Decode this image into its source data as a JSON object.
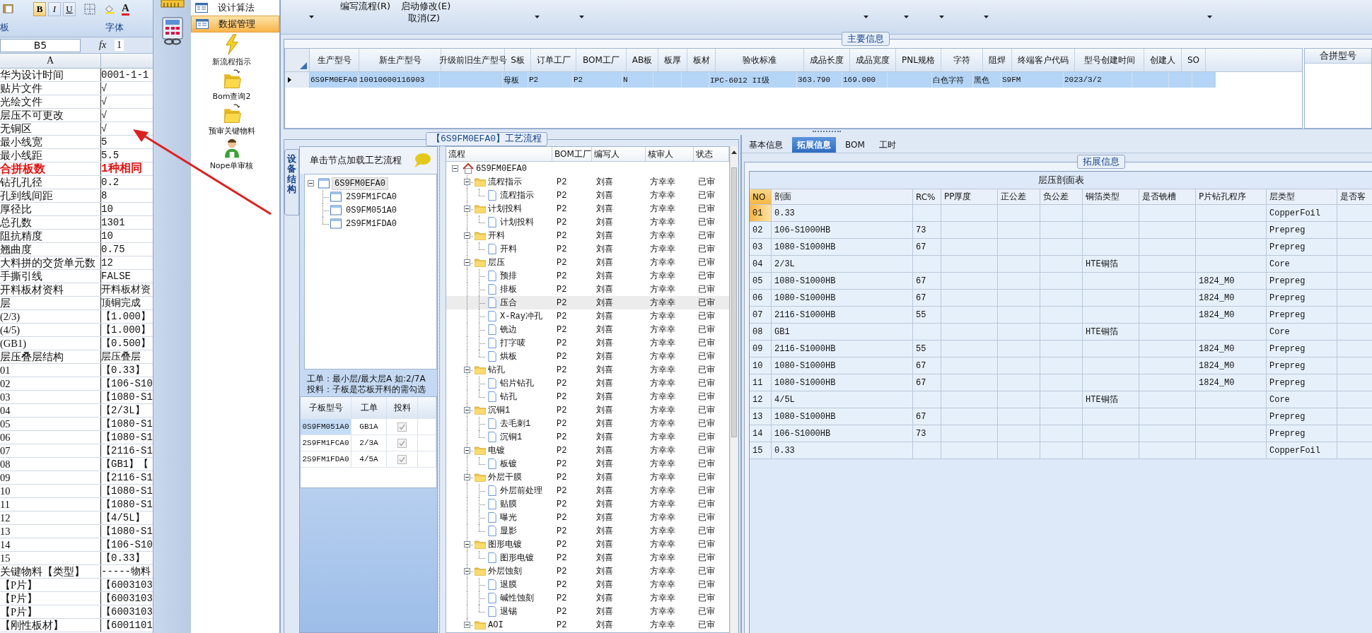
{
  "excel": {
    "format_buttons": [
      "B",
      "I",
      "U"
    ],
    "font_color_label": "A",
    "group_labels": [
      "板",
      "字体"
    ],
    "name_box": "B5",
    "fx_label": "fx",
    "formula_value": "1",
    "column_header": "A",
    "rows": [
      {
        "label": "华为设计时间",
        "value": "0001-1-1",
        "emphasized": false
      },
      {
        "label": "贴片文件",
        "value": "√",
        "emphasized": false
      },
      {
        "label": "光绘文件",
        "value": "√",
        "emphasized": false
      },
      {
        "label": "层压不可更改",
        "value": "√",
        "emphasized": false
      },
      {
        "label": "无铜区",
        "value": "√",
        "emphasized": false
      },
      {
        "label": "最小线宽",
        "value": "5",
        "emphasized": false
      },
      {
        "label": "最小线距",
        "value": "5.5",
        "emphasized": false
      },
      {
        "label": "合拼板数",
        "value": "1种相同",
        "emphasized": true
      },
      {
        "label": "钻孔孔径",
        "value": "0.2",
        "emphasized": false
      },
      {
        "label": "孔到线间距",
        "value": "8",
        "emphasized": false
      },
      {
        "label": "厚径比",
        "value": "10",
        "emphasized": false
      },
      {
        "label": "总孔数",
        "value": "1301",
        "emphasized": false
      },
      {
        "label": "阻抗精度",
        "value": "10",
        "emphasized": false
      },
      {
        "label": "翘曲度",
        "value": "0.75",
        "emphasized": false
      },
      {
        "label": "大料拼的交货单元数",
        "value": "12",
        "emphasized": false
      },
      {
        "label": "手撕引线",
        "value": "FALSE",
        "emphasized": false
      },
      {
        "label": "开料板材资料",
        "value": "开料板材资",
        "emphasized": false
      },
      {
        "label": "层",
        "value": "顶铜完成",
        "emphasized": false
      },
      {
        "label": "(2/3)",
        "value": "【1.000】",
        "emphasized": false
      },
      {
        "label": "(4/5)",
        "value": "【1.000】",
        "emphasized": false
      },
      {
        "label": "(GB1)",
        "value": "【0.500】",
        "emphasized": false
      },
      {
        "label": "层压叠层结构",
        "value": "层压叠层",
        "emphasized": false
      },
      {
        "label": "01",
        "value": "【0.33】",
        "emphasized": false
      },
      {
        "label": "02",
        "value": "【106-S10",
        "emphasized": false
      },
      {
        "label": "03",
        "value": "【1080-S1",
        "emphasized": false
      },
      {
        "label": "04",
        "value": "【2/3L】",
        "emphasized": false
      },
      {
        "label": "05",
        "value": "【1080-S1",
        "emphasized": false
      },
      {
        "label": "06",
        "value": "【1080-S1",
        "emphasized": false
      },
      {
        "label": "07",
        "value": "【2116-S1",
        "emphasized": false
      },
      {
        "label": "08",
        "value": "【GB1】【",
        "emphasized": false
      },
      {
        "label": "09",
        "value": "【2116-S1",
        "emphasized": false
      },
      {
        "label": "10",
        "value": "【1080-S1",
        "emphasized": false
      },
      {
        "label": "11",
        "value": "【1080-S1",
        "emphasized": false
      },
      {
        "label": "12",
        "value": "【4/5L】",
        "emphasized": false
      },
      {
        "label": "13",
        "value": "【1080-S1",
        "emphasized": false
      },
      {
        "label": "14",
        "value": "【106-S10",
        "emphasized": false
      },
      {
        "label": "15",
        "value": "【0.33】",
        "emphasized": false
      },
      {
        "label": "关键物料【类型】",
        "value": "-----物料",
        "emphasized": false
      },
      {
        "label": "【P片】",
        "value": "【6003103",
        "emphasized": false
      },
      {
        "label": "【P片】",
        "value": "【6003103",
        "emphasized": false
      },
      {
        "label": "【P片】",
        "value": "【6003103",
        "emphasized": false
      },
      {
        "label": "【刚性板材】",
        "value": "【6001101",
        "emphasized": false
      }
    ]
  },
  "nav": {
    "items": [
      {
        "label": "设计算法",
        "kind": "row",
        "selected": false
      },
      {
        "label": "数据管理",
        "kind": "row",
        "selected": true
      },
      {
        "label": "新流程指示",
        "kind": "tile",
        "selected": false
      },
      {
        "label": "Bom查询2",
        "kind": "tile",
        "selected": false
      },
      {
        "label": "预审关键物料",
        "kind": "tile",
        "selected": false
      },
      {
        "label": "Nope单审核",
        "kind": "tile",
        "selected": false
      }
    ]
  },
  "toolbar": {
    "actions": [
      "编写流程(R)",
      "启动修改(E)",
      "取消(Z)"
    ]
  },
  "main_info": {
    "title": "主要信息",
    "side_title": "合拼型号",
    "columns": [
      "生产型号",
      "新生产型号",
      "升级前旧生产型号",
      "S板",
      "订单工厂",
      "BOM工厂",
      "AB板",
      "板厚",
      "板材",
      "验收标准",
      "成品长度",
      "成品宽度",
      "PNL规格",
      "字符",
      "阻焊",
      "终端客户代码",
      "型号创建时间",
      "创建人",
      "SO"
    ],
    "rows": [
      {
        "selected": true,
        "cells": [
          "6S9FM0EFA0",
          "10010600116903",
          null,
          "母板",
          "P2",
          "P2",
          "N",
          null,
          null,
          "IPC-6012 II级",
          "363.790",
          "169.000",
          null,
          "白色字符",
          "黑色",
          "S9FM",
          "2023/3/2",
          null,
          null
        ]
      }
    ]
  },
  "process_flow": {
    "title": "【6S9FM0EFA0】工艺流程",
    "side_tab": "设备结构",
    "hint": "单击节点加载工艺流程",
    "structure_tree": {
      "label": "6S9FM0EFA0",
      "selected": true,
      "expanded": true,
      "children": [
        {
          "label": "2S9FM1FCA0",
          "selected": false
        },
        {
          "label": "0S9FM051A0",
          "selected": false
        },
        {
          "label": "2S9FM1FDA0",
          "selected": false
        }
      ]
    },
    "notes": [
      "工单：最小层/最大层A 如:2/7A",
      "投料：子板是芯板开料的需勾选"
    ],
    "sub_boards": {
      "columns": [
        "子板型号",
        "工单",
        "投料"
      ],
      "rows": [
        {
          "model": "0S9FM051A0",
          "order": "GB1A",
          "feed": true,
          "selected": true
        },
        {
          "model": "2S9FM1FCA0",
          "order": "2/3A",
          "feed": true,
          "selected": false
        },
        {
          "model": "2S9FM1FDA0",
          "order": "4/5A",
          "feed": true,
          "selected": false
        }
      ]
    },
    "flow": {
      "columns": [
        "流程",
        "BOM工厂",
        "编写人",
        "核审人",
        "状态"
      ],
      "root": {
        "label": "6S9FM0EFA0",
        "expanded": true,
        "selected": false,
        "children": [
          {
            "label": "流程指示",
            "bom_factory": "P2",
            "writer": "刘喜",
            "reviewer": "方幸幸",
            "status": "已审",
            "expanded": true,
            "selected": false,
            "children": [
              {
                "label": "流程指示",
                "bom_factory": "P2",
                "writer": "刘喜",
                "reviewer": "方幸幸",
                "status": "已审",
                "selected": false
              }
            ]
          },
          {
            "label": "计划投料",
            "bom_factory": "P2",
            "writer": "刘喜",
            "reviewer": "方幸幸",
            "status": "已审",
            "expanded": true,
            "selected": false,
            "children": [
              {
                "label": "计划投料",
                "bom_factory": "P2",
                "writer": "刘喜",
                "reviewer": "方幸幸",
                "status": "已审",
                "selected": false
              }
            ]
          },
          {
            "label": "开料",
            "bom_factory": "P2",
            "writer": "刘喜",
            "reviewer": "方幸幸",
            "status": "已审",
            "expanded": true,
            "selected": false,
            "children": [
              {
                "label": "开料",
                "bom_factory": "P2",
                "writer": "刘喜",
                "reviewer": "方幸幸",
                "status": "已审",
                "selected": false
              }
            ]
          },
          {
            "label": "层压",
            "bom_factory": "P2",
            "writer": "刘喜",
            "reviewer": "方幸幸",
            "status": "已审",
            "expanded": true,
            "selected": false,
            "children": [
              {
                "label": "预排",
                "bom_factory": "P2",
                "writer": "刘喜",
                "reviewer": "方幸幸",
                "status": "已审",
                "selected": false
              },
              {
                "label": "排板",
                "bom_factory": "P2",
                "writer": "刘喜",
                "reviewer": "方幸幸",
                "status": "已审",
                "selected": false
              },
              {
                "label": "压合",
                "bom_factory": "P2",
                "writer": "刘喜",
                "reviewer": "方幸幸",
                "status": "已审",
                "selected": true
              },
              {
                "label": "X-Ray冲孔",
                "bom_factory": "P2",
                "writer": "刘喜",
                "reviewer": "方幸幸",
                "status": "已审",
                "selected": false
              },
              {
                "label": "铣边",
                "bom_factory": "P2",
                "writer": "刘喜",
                "reviewer": "方幸幸",
                "status": "已审",
                "selected": false
              },
              {
                "label": "打字唛",
                "bom_factory": "P2",
                "writer": "刘喜",
                "reviewer": "方幸幸",
                "status": "已审",
                "selected": false
              },
              {
                "label": "烘板",
                "bom_factory": "P2",
                "writer": "刘喜",
                "reviewer": "方幸幸",
                "status": "已审",
                "selected": false
              }
            ]
          },
          {
            "label": "钻孔",
            "bom_factory": "P2",
            "writer": "刘喜",
            "reviewer": "方幸幸",
            "status": "已审",
            "expanded": true,
            "selected": false,
            "children": [
              {
                "label": "铝片钻孔",
                "bom_factory": "P2",
                "writer": "刘喜",
                "reviewer": "方幸幸",
                "status": "已审",
                "selected": false
              },
              {
                "label": "钻孔",
                "bom_factory": "P2",
                "writer": "刘喜",
                "reviewer": "方幸幸",
                "status": "已审",
                "selected": false
              }
            ]
          },
          {
            "label": "沉铜1",
            "bom_factory": "P2",
            "writer": "刘喜",
            "reviewer": "方幸幸",
            "status": "已审",
            "expanded": true,
            "selected": false,
            "children": [
              {
                "label": "去毛刺1",
                "bom_factory": "P2",
                "writer": "刘喜",
                "reviewer": "方幸幸",
                "status": "已审",
                "selected": false
              },
              {
                "label": "沉铜1",
                "bom_factory": "P2",
                "writer": "刘喜",
                "reviewer": "方幸幸",
                "status": "已审",
                "selected": false
              }
            ]
          },
          {
            "label": "电镀",
            "bom_factory": "P2",
            "writer": "刘喜",
            "reviewer": "方幸幸",
            "status": "已审",
            "expanded": true,
            "selected": false,
            "children": [
              {
                "label": "板镀",
                "bom_factory": "P2",
                "writer": "刘喜",
                "reviewer": "方幸幸",
                "status": "已审",
                "selected": false
              }
            ]
          },
          {
            "label": "外层干膜",
            "bom_factory": "P2",
            "writer": "刘喜",
            "reviewer": "方幸幸",
            "status": "已审",
            "expanded": true,
            "selected": false,
            "children": [
              {
                "label": "外层前处理",
                "bom_factory": "P2",
                "writer": "刘喜",
                "reviewer": "方幸幸",
                "status": "已审",
                "selected": false
              },
              {
                "label": "贴膜",
                "bom_factory": "P2",
                "writer": "刘喜",
                "reviewer": "方幸幸",
                "status": "已审",
                "selected": false
              },
              {
                "label": "曝光",
                "bom_factory": "P2",
                "writer": "刘喜",
                "reviewer": "方幸幸",
                "status": "已审",
                "selected": false
              },
              {
                "label": "显影",
                "bom_factory": "P2",
                "writer": "刘喜",
                "reviewer": "方幸幸",
                "status": "已审",
                "selected": false
              }
            ]
          },
          {
            "label": "图形电镀",
            "bom_factory": "P2",
            "writer": "刘喜",
            "reviewer": "方幸幸",
            "status": "已审",
            "expanded": true,
            "selected": false,
            "children": [
              {
                "label": "图形电镀",
                "bom_factory": "P2",
                "writer": "刘喜",
                "reviewer": "方幸幸",
                "status": "已审",
                "selected": false
              }
            ]
          },
          {
            "label": "外层蚀刻",
            "bom_factory": "P2",
            "writer": "刘喜",
            "reviewer": "方幸幸",
            "status": "已审",
            "expanded": true,
            "selected": false,
            "children": [
              {
                "label": "退膜",
                "bom_factory": "P2",
                "writer": "刘喜",
                "reviewer": "方幸幸",
                "status": "已审",
                "selected": false
              },
              {
                "label": "碱性蚀刻",
                "bom_factory": "P2",
                "writer": "刘喜",
                "reviewer": "方幸幸",
                "status": "已审",
                "selected": false
              },
              {
                "label": "退锡",
                "bom_factory": "P2",
                "writer": "刘喜",
                "reviewer": "方幸幸",
                "status": "已审",
                "selected": false
              }
            ]
          },
          {
            "label": "AOI",
            "bom_factory": "P2",
            "writer": "刘喜",
            "reviewer": "方幸幸",
            "status": "已审",
            "expanded": true,
            "selected": false
          }
        ]
      }
    }
  },
  "detail": {
    "tabs": [
      {
        "label": "基本信息",
        "selected": false
      },
      {
        "label": "拓展信息",
        "selected": true
      },
      {
        "label": "BOM",
        "selected": false
      },
      {
        "label": "工时",
        "selected": false
      }
    ],
    "group_title": "拓展信息",
    "table": {
      "title": "层压剖面表",
      "columns": [
        "NO",
        "剖面",
        "RC%",
        "PP厚度",
        "正公差",
        "负公差",
        "铜箔类型",
        "是否铣槽",
        "P片钻孔程序",
        "层类型",
        "是否客"
      ],
      "rows": [
        {
          "selected": true,
          "cells": [
            "01",
            "0.33",
            null,
            null,
            null,
            null,
            null,
            null,
            null,
            "CopperFoil",
            null
          ]
        },
        {
          "selected": false,
          "cells": [
            "02",
            "106-S1000HB",
            "73",
            null,
            null,
            null,
            null,
            null,
            null,
            "Prepreg",
            null
          ]
        },
        {
          "selected": false,
          "cells": [
            "03",
            "1080-S1000HB",
            "67",
            null,
            null,
            null,
            null,
            null,
            null,
            "Prepreg",
            null
          ]
        },
        {
          "selected": false,
          "cells": [
            "04",
            "2/3L",
            null,
            null,
            null,
            null,
            "HTE铜箔",
            null,
            null,
            "Core",
            null
          ]
        },
        {
          "selected": false,
          "cells": [
            "05",
            "1080-S1000HB",
            "67",
            null,
            null,
            null,
            null,
            null,
            "1824_M0",
            "Prepreg",
            null
          ]
        },
        {
          "selected": false,
          "cells": [
            "06",
            "1080-S1000HB",
            "67",
            null,
            null,
            null,
            null,
            null,
            "1824_M0",
            "Prepreg",
            null
          ]
        },
        {
          "selected": false,
          "cells": [
            "07",
            "2116-S1000HB",
            "55",
            null,
            null,
            null,
            null,
            null,
            "1824_M0",
            "Prepreg",
            null
          ]
        },
        {
          "selected": false,
          "cells": [
            "08",
            "GB1",
            null,
            null,
            null,
            null,
            "HTE铜箔",
            null,
            null,
            "Core",
            null
          ]
        },
        {
          "selected": false,
          "cells": [
            "09",
            "2116-S1000HB",
            "55",
            null,
            null,
            null,
            null,
            null,
            "1824_M0",
            "Prepreg",
            null
          ]
        },
        {
          "selected": false,
          "cells": [
            "10",
            "1080-S1000HB",
            "67",
            null,
            null,
            null,
            null,
            null,
            "1824_M0",
            "Prepreg",
            null
          ]
        },
        {
          "selected": false,
          "cells": [
            "11",
            "1080-S1000HB",
            "67",
            null,
            null,
            null,
            null,
            null,
            "1824_M0",
            "Prepreg",
            null
          ]
        },
        {
          "selected": false,
          "cells": [
            "12",
            "4/5L",
            null,
            null,
            null,
            null,
            "HTE铜箔",
            null,
            null,
            "Core",
            null
          ]
        },
        {
          "selected": false,
          "cells": [
            "13",
            "1080-S1000HB",
            "67",
            null,
            null,
            null,
            null,
            null,
            null,
            "Prepreg",
            null
          ]
        },
        {
          "selected": false,
          "cells": [
            "14",
            "106-S1000HB",
            "73",
            null,
            null,
            null,
            null,
            null,
            null,
            "Prepreg",
            null
          ]
        },
        {
          "selected": false,
          "cells": [
            "15",
            "0.33",
            null,
            null,
            null,
            null,
            null,
            null,
            null,
            "CopperFoil",
            null
          ]
        }
      ]
    }
  }
}
